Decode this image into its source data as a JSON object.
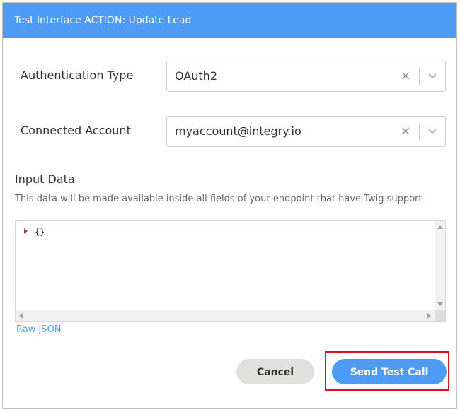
{
  "dialog": {
    "title": "Test Interface ACTION: Update Lead"
  },
  "fields": {
    "auth_type": {
      "label": "Authentication Type",
      "value": "OAuth2",
      "clear_glyph": "×"
    },
    "connected_account": {
      "label": "Connected Account",
      "value": "myaccount@integry.io",
      "clear_glyph": "×"
    }
  },
  "input_data": {
    "title": "Input Data",
    "description": "This data will be made available inside all fields of your endpoint that have Twig support",
    "editor_value": "{}",
    "raw_json_link": "Raw JSON"
  },
  "actions": {
    "cancel_label": "Cancel",
    "send_label": "Send Test Call"
  },
  "colors": {
    "header_bg": "#4d9bf5",
    "primary_button": "#4d9bf5",
    "highlight_border": "#e0111a"
  },
  "icons": {
    "clear": "close-icon",
    "dropdown": "chevron-down-icon",
    "tree_toggle": "caret-right-icon"
  }
}
